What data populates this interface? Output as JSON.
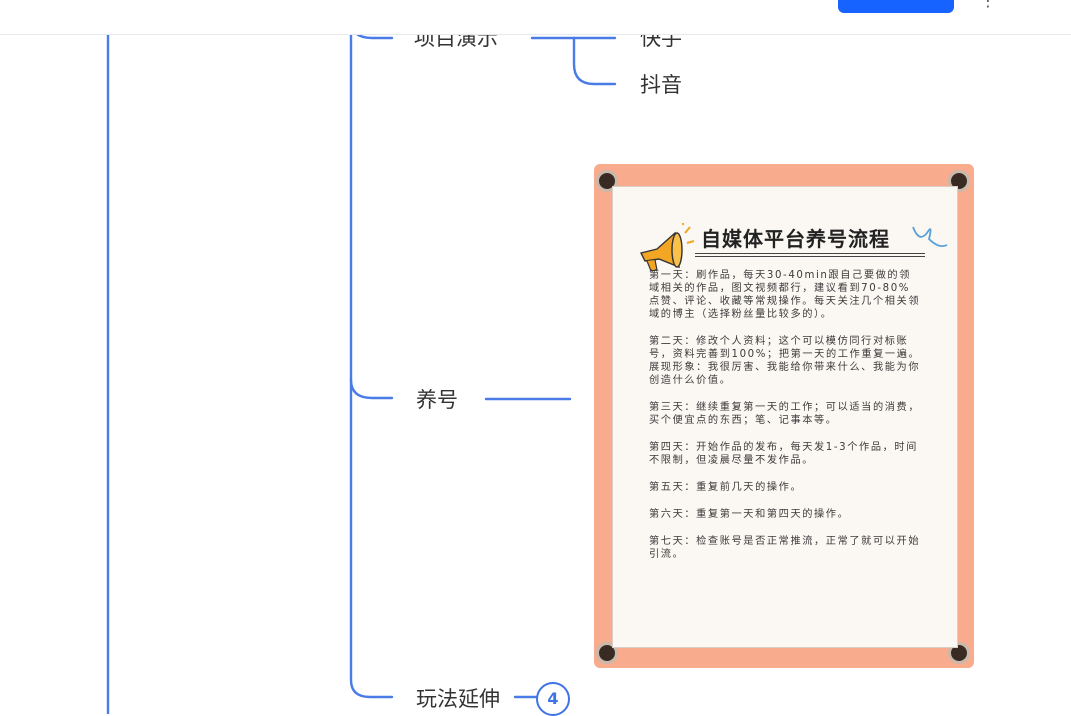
{
  "mindmap": {
    "nodes": {
      "demo": "项目演示",
      "kuaishou": "快手",
      "douyin": "抖音",
      "yanghao": "养号",
      "extension": "玩法延伸"
    },
    "extension_count": "4"
  },
  "poster": {
    "title": "自媒体平台养号流程",
    "paragraphs": [
      "第一天：刷作品，每天30-40min跟自己要做的领域相关的作品，图文视频都行，建议看到70-80%点赞、评论、收藏等常规操作。每天关注几个相关领域的博主（选择粉丝量比较多的）。",
      "第二天：修改个人资料；这个可以模仿同行对标账号，资料完善到100%；把第一天的工作重复一遍。\n展现形象：我很厉害、我能给你带来什么、我能为你创造什么价值。",
      "第三天：继续重复第一天的工作；可以适当的消费，买个便宜点的东西；笔、记事本等。",
      "第四天：开始作品的发布，每天发1-3个作品，时间不限制，但凌晨尽量不发作品。",
      "第五天：重复前几天的操作。",
      "第六天：重复第一天和第四天的操作。",
      "第七天：检查账号是否正常推流，正常了就可以开始引流。"
    ]
  },
  "colors": {
    "connector": "#4a7be6",
    "poster_border": "#f9ab8e",
    "topbar_button": "#1663ff"
  }
}
